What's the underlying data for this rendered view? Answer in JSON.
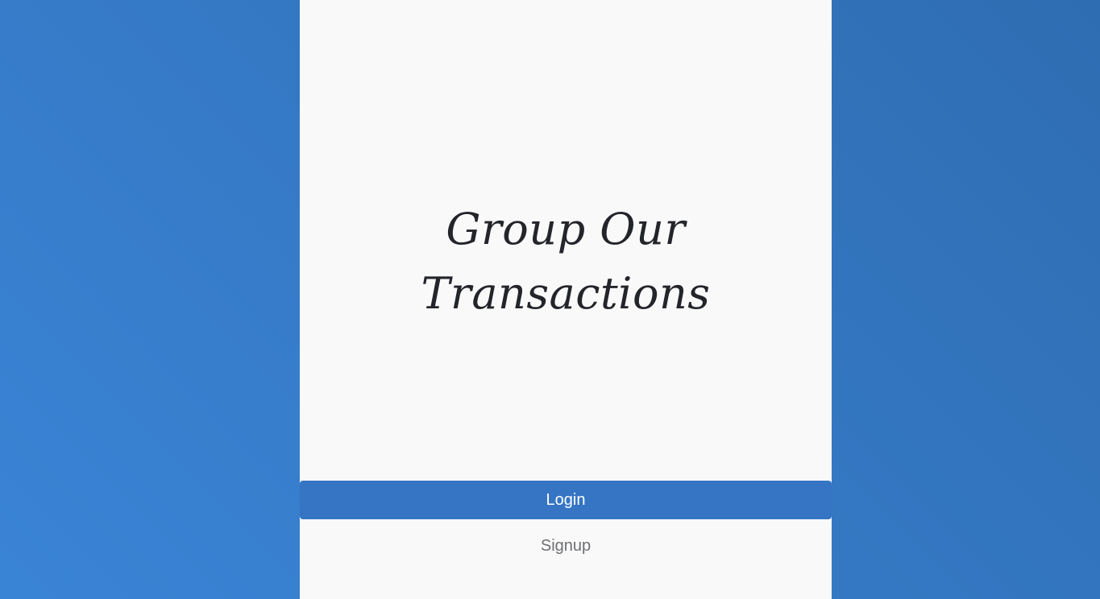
{
  "app": {
    "title": "Group Our Transactions"
  },
  "actions": {
    "login_label": "Login",
    "signup_label": "Signup"
  },
  "colors": {
    "background_gradient_start": "#3a84d6",
    "background_gradient_end": "#2f6db2",
    "panel": "#f9f9f9",
    "primary_button": "#3575c4",
    "title_text": "#23252b",
    "secondary_text": "#6d6f73"
  }
}
